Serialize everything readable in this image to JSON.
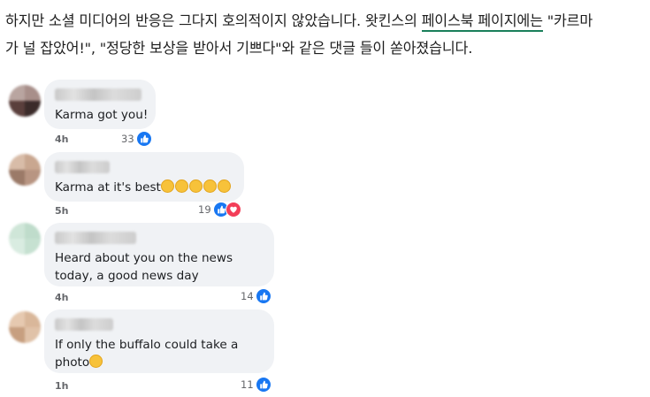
{
  "article": {
    "line1_prefix": "하지만 소셜 미디어의 반응은 그다지 호의적이지 않았습니다. 왓킨스의 ",
    "line1_link": "페이스북 페이지에는",
    "line1_suffix": " \"카르마",
    "line2": "가 널 잡았어!\", \"정당한 보상을 받아서 기쁘다\"와 같은 댓글 들이 쏟아졌습니다."
  },
  "comments": [
    {
      "text_lines": [
        "Karma got you!"
      ],
      "emojis": [],
      "time": "4h",
      "reaction_count": "33",
      "reactions": [
        "like-icon"
      ]
    },
    {
      "text_lines": [
        "Karma at it's best"
      ],
      "emojis": [
        "laughing-emoji",
        "rolling-laughing-emoji",
        "laughing-emoji",
        "laughing-emoji",
        "laughing-emoji"
      ],
      "time": "5h",
      "reaction_count": "19",
      "reactions": [
        "like-icon",
        "love-icon"
      ]
    },
    {
      "text_lines": [
        "Heard about you on the news",
        "today, a good news day"
      ],
      "emojis": [],
      "time": "4h",
      "reaction_count": "14",
      "reactions": [
        "like-icon"
      ]
    },
    {
      "text_lines": [
        "If only the buffalo could take a",
        "photo"
      ],
      "emojis": [
        "winking-tongue-emoji"
      ],
      "time": "1h",
      "reaction_count": "11",
      "reactions": [
        "like-icon"
      ]
    }
  ],
  "colors": {
    "bubble": "#f0f2f5",
    "like": "#1877f2",
    "love": "#f33e58",
    "link_underline": "#1a7f5a",
    "meta_text": "#65676b"
  }
}
